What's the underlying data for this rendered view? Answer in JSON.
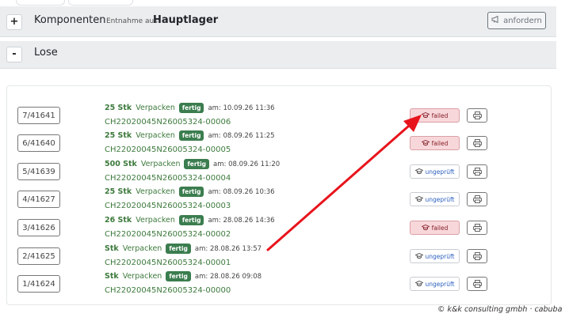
{
  "komponenten": {
    "toggle": "+",
    "title": "Komponenten",
    "entnahme_label": "Entnahme aus",
    "lager": "Hauptlager",
    "anfordern_label": "anfordern"
  },
  "lose": {
    "toggle": "-",
    "title": "Lose",
    "rows": [
      {
        "id": "7/41641",
        "qty": "25 Stk",
        "op": "Verpacken",
        "badge": "fertig",
        "am": "am: 10.09.26 11:36",
        "charge": "CH22020045N26005324-00006",
        "status": "failed"
      },
      {
        "id": "6/41640",
        "qty": "25 Stk",
        "op": "Verpacken",
        "badge": "fertig",
        "am": "am: 08.09.26 11:25",
        "charge": "CH22020045N26005324-00005",
        "status": "failed"
      },
      {
        "id": "5/41639",
        "qty": "500 Stk",
        "op": "Verpacken",
        "badge": "fertig",
        "am": "am: 08.09.26 11:20",
        "charge": "CH22020045N26005324-00004",
        "status": "ungeprüft"
      },
      {
        "id": "4/41627",
        "qty": "25 Stk",
        "op": "Verpacken",
        "badge": "fertig",
        "am": "am: 08.09.26 10:36",
        "charge": "CH22020045N26005324-00003",
        "status": "ungeprüft"
      },
      {
        "id": "3/41626",
        "qty": "26 Stk",
        "op": "Verpacken",
        "badge": "fertig",
        "am": "am: 28.08.26 14:36",
        "charge": "CH22020045N26005324-00002",
        "status": "failed"
      },
      {
        "id": "2/41625",
        "qty": "Stk",
        "op": "Verpacken",
        "badge": "fertig",
        "am": "am: 28.08.26 13:57",
        "charge": "CH22020045N26005324-00001",
        "status": "ungeprüft"
      },
      {
        "id": "1/41624",
        "qty": "Stk",
        "op": "Verpacken",
        "badge": "fertig",
        "am": "am: 28.08.26 09:08",
        "charge": "CH22020045N26005324-00000",
        "status": "ungeprüft"
      }
    ]
  },
  "footer": "© k&k consulting gmbh · cabuba",
  "icons": {
    "status": "graduation-cap-icon",
    "print": "printer-icon",
    "anfordern": "megaphone-icon"
  },
  "colors": {
    "failed_bg": "#f8d7da",
    "ungeprueft_text": "#2a5fbf",
    "badge_green": "#3b7d4e",
    "annotation_arrow": "#e8141c"
  }
}
